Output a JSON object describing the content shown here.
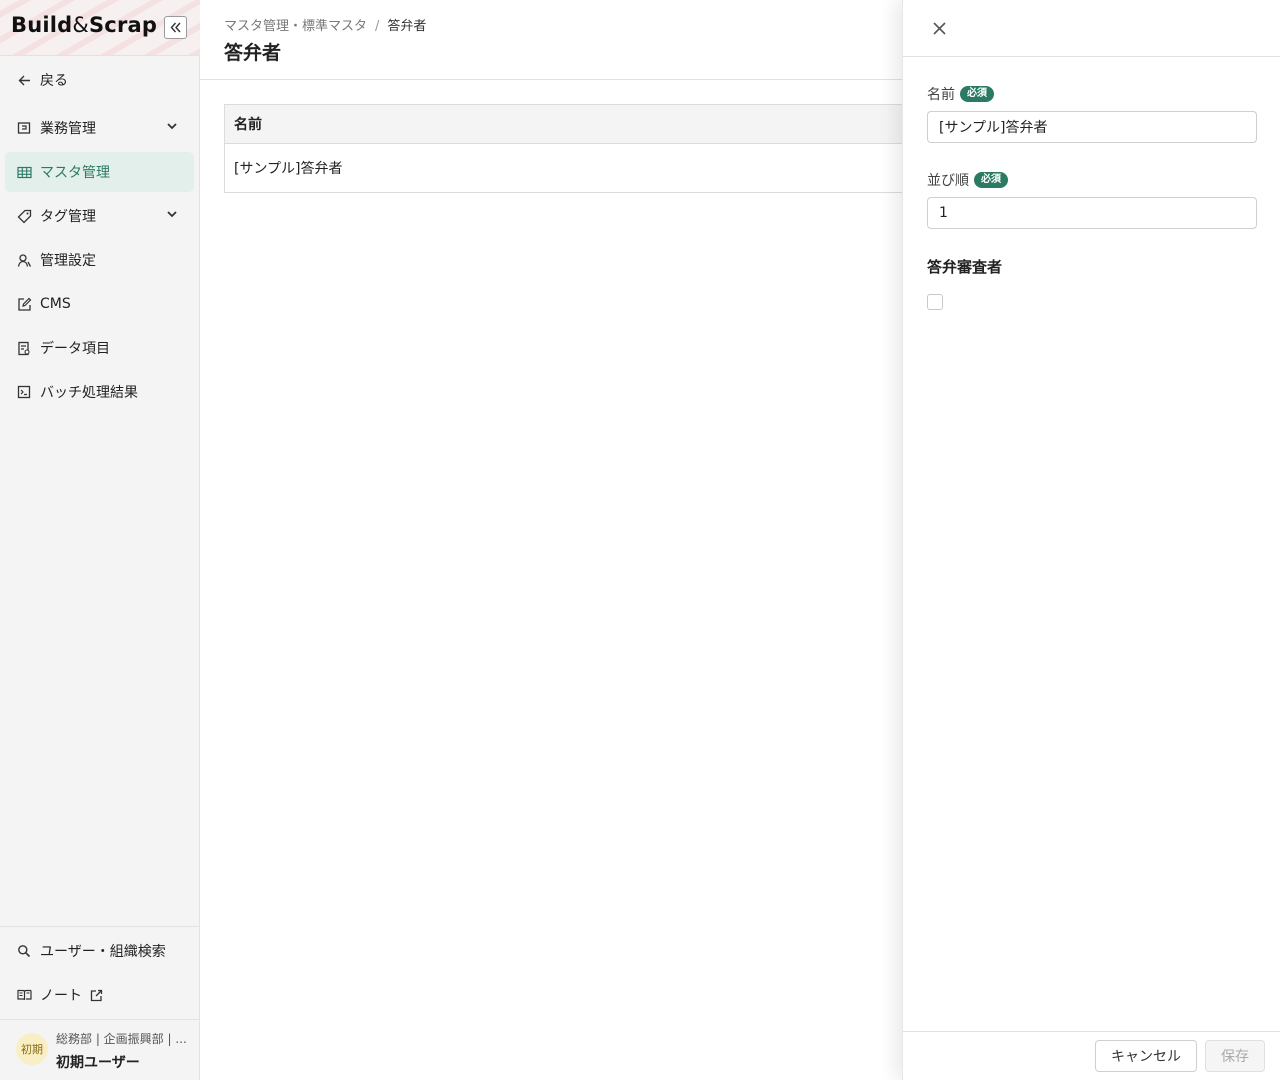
{
  "app": {
    "logo_text_a": "Build",
    "logo_text_amp": "&",
    "logo_text_b": "Scrap"
  },
  "sidebar": {
    "back_label": "戻る",
    "items": [
      {
        "label": "業務管理",
        "icon": "briefcase-icon",
        "expandable": true
      },
      {
        "label": "マスタ管理",
        "icon": "table-icon",
        "active": true
      },
      {
        "label": "タグ管理",
        "icon": "tag-icon",
        "expandable": true
      },
      {
        "label": "管理設定",
        "icon": "user-settings-icon"
      },
      {
        "label": "CMS",
        "icon": "edit-icon"
      },
      {
        "label": "データ項目",
        "icon": "document-icon"
      },
      {
        "label": "バッチ処理結果",
        "icon": "terminal-icon"
      }
    ],
    "bottom_items": [
      {
        "label": "ユーザー・組織検索",
        "icon": "search-icon"
      },
      {
        "label": "ノート",
        "icon": "book-icon"
      }
    ],
    "user": {
      "avatar_text": "初期",
      "dept": "総務部 | 企画振興部 | ...",
      "name": "初期ユーザー"
    }
  },
  "main": {
    "breadcrumb_parent": "マスタ管理・標準マスタ",
    "breadcrumb_sep": "/",
    "breadcrumb_current": "答弁者",
    "title": "答弁者",
    "table": {
      "header": "名前",
      "rows": [
        "[サンプル]答弁者"
      ]
    }
  },
  "drawer": {
    "name_label": "名前",
    "required_badge": "必須",
    "name_value": "[サンプル]答弁者",
    "order_label": "並び順",
    "order_value": "1",
    "reviewer_section": "答弁審査者",
    "reviewer_checked": false,
    "cancel_label": "キャンセル",
    "save_label": "保存"
  },
  "colors": {
    "accent": "#2b7a63",
    "active_bg": "#e2efeb",
    "sidebar_bg": "#f4f4f4"
  }
}
